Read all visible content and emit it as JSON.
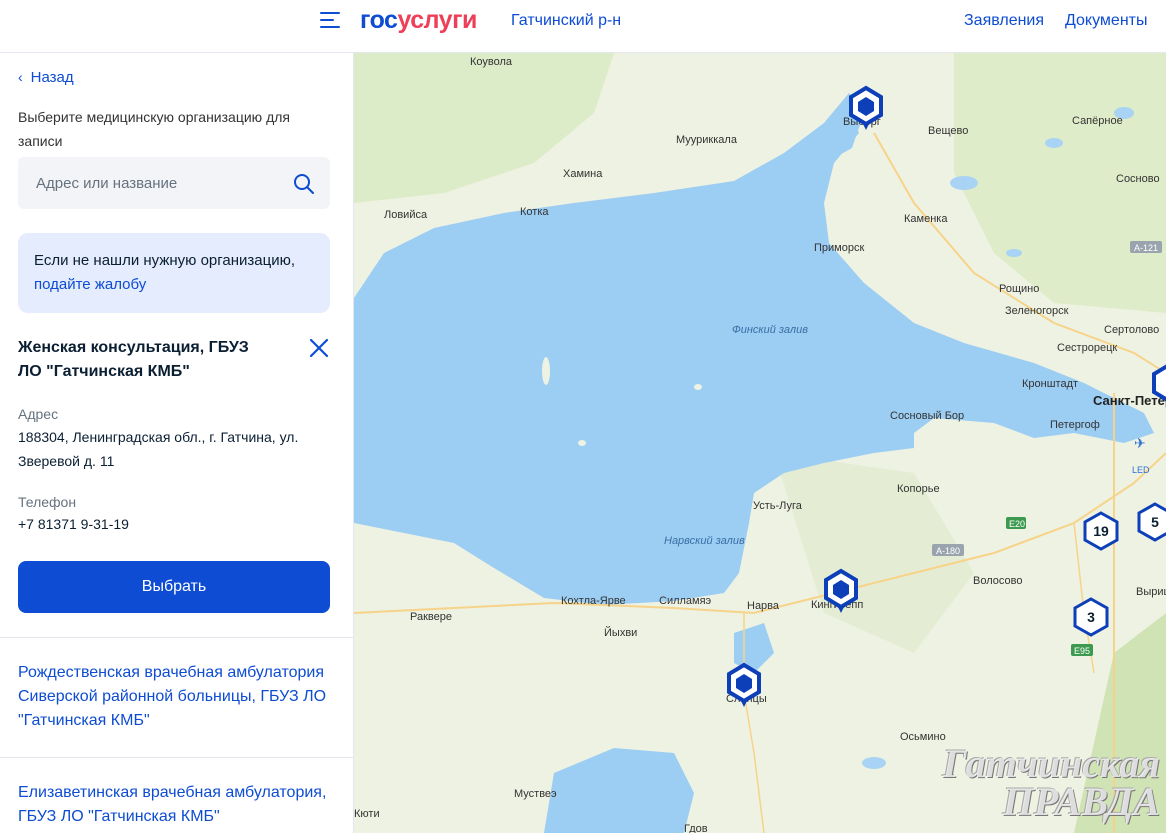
{
  "header": {
    "logo_part1": "гос",
    "logo_part2": "услуги",
    "region": "Гатчинский р-н",
    "nav_applications": "Заявления",
    "nav_documents": "Документы"
  },
  "sidebar": {
    "back_label": "Назад",
    "prompt": "Выберите медицинскую организацию для записи",
    "search_placeholder": "Адрес или название",
    "notice_text": "Если не нашли нужную организацию,",
    "notice_link": "подайте жалобу",
    "selected_org": {
      "title": "Женская консультация, ГБУЗ ЛО \"Гатчинская КМБ\"",
      "address_label": "Адрес",
      "address": "188304, Ленинградская обл., г. Гатчина, ул. Зверевой д. 11",
      "phone_label": "Телефон",
      "phone": "+7 81371 9-31-19",
      "select_button": "Выбрать"
    },
    "other_orgs": [
      "Рождественская врачебная амбулатория Сиверской районной больницы, ГБУЗ ЛО \"Гатчинская КМБ\"",
      "Елизаветинская врачебная амбулатория, ГБУЗ ЛО \"Гатчинская КМБ\""
    ]
  },
  "map": {
    "sea_labels": [
      "Финский залив",
      "Нарвский залив"
    ],
    "places": [
      "Коувола",
      "Выборг",
      "Вещево",
      "Сапёрное",
      "Мууриккала",
      "Хамина",
      "Сосново",
      "Ловийса",
      "Котка",
      "Каменка",
      "Приморск",
      "Рощино",
      "Зеленогорск",
      "Сертолово",
      "Сестрорецк",
      "Кронштадт",
      "Санкт-Петербург",
      "Петергоф",
      "Сосновый Бор",
      "Копорье",
      "Усть-Луга",
      "Волосово",
      "Ракверe",
      "Кохтла-Ярве",
      "Силламяэ",
      "Нарва",
      "Кингисепп",
      "Йыхви",
      "Сланцы",
      "Осьмино",
      "Муствеэ",
      "Кюти",
      "Гдов",
      "Вырица"
    ],
    "roads": [
      "А-121",
      "Е20",
      "А-180",
      "Е95",
      "LED"
    ],
    "clusters": [
      "19",
      "5",
      "3"
    ],
    "watermark_line1": "Гатчинская",
    "watermark_line2": "ПРАВДА"
  }
}
